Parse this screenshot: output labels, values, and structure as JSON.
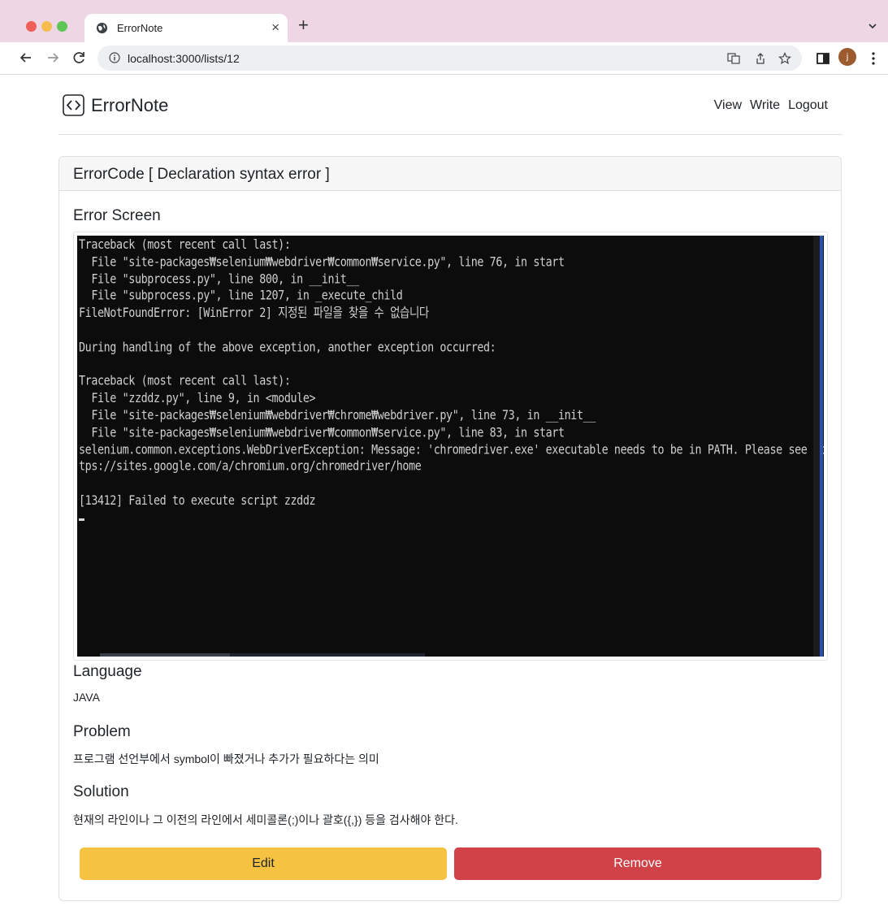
{
  "browser": {
    "tab_title": "ErrorNote",
    "tab_close": "×",
    "new_tab": "+",
    "url": "localhost:3000/lists/12",
    "avatar_letter": "j"
  },
  "brand": {
    "name": "ErrorNote",
    "icon": "code-brackets-icon"
  },
  "nav": {
    "view": "View",
    "write": "Write",
    "logout": "Logout"
  },
  "card": {
    "header": "ErrorCode [ Declaration syntax error ]",
    "error_screen_title": "Error Screen",
    "console_text": "Traceback (most recent call last):\n  File \"site-packages₩selenium₩webdriver₩common₩service.py\", line 76, in start\n  File \"subprocess.py\", line 800, in __init__\n  File \"subprocess.py\", line 1207, in _execute_child\nFileNotFoundError: [WinError 2] 지정된 파일을 찾을 수 없습니다\n\nDuring handling of the above exception, another exception occurred:\n\nTraceback (most recent call last):\n  File \"zzddz.py\", line 9, in <module>\n  File \"site-packages₩selenium₩webdriver₩chrome₩webdriver.py\", line 73, in __init__\n  File \"site-packages₩selenium₩webdriver₩common₩service.py\", line 83, in start\nselenium.common.exceptions.WebDriverException: Message: 'chromedriver.exe' executable needs to be in PATH. Please see ht\ntps://sites.google.com/a/chromium.org/chromedriver/home\n\n[13412] Failed to execute script zzddz",
    "language_title": "Language",
    "language_value": "JAVA",
    "problem_title": "Problem",
    "problem_text": "프로그램 선언부에서 symbol이 빠졌거나 추가가 필요하다는 의미",
    "solution_title": "Solution",
    "solution_text": "현재의 라인이나 그 이전의 라인에서 세미콜론(;)이나 괄호({,}) 등을 검사해야 한다.",
    "edit_label": "Edit",
    "remove_label": "Remove"
  },
  "colors": {
    "edit": "#f5c242",
    "remove": "#d14148",
    "tabbar": "#efd6e4"
  }
}
